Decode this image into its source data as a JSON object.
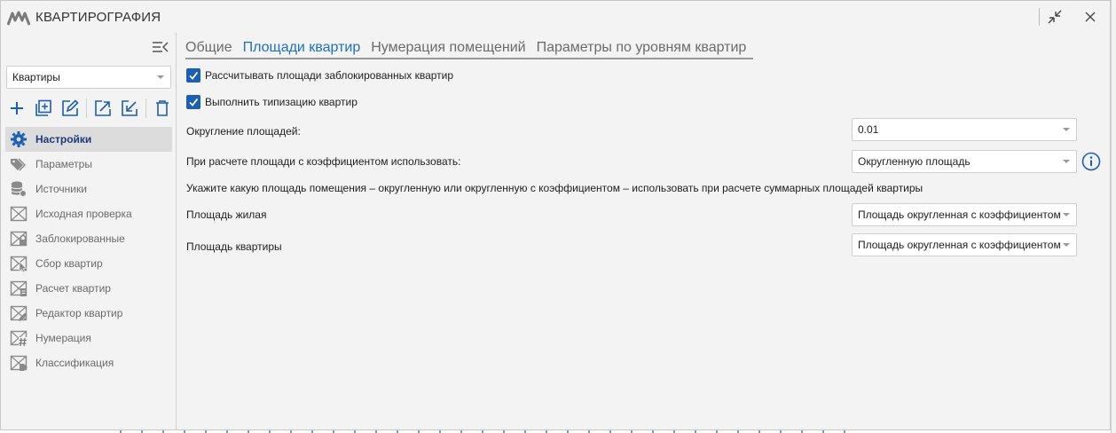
{
  "window": {
    "title": "КВАРТИРОГРАФИЯ"
  },
  "sidebar": {
    "dropdown_value": "Квартиры",
    "nav": [
      {
        "label": "Настройки",
        "icon": "gear-icon",
        "active": true
      },
      {
        "label": "Параметры",
        "icon": "tags-icon"
      },
      {
        "label": "Источники",
        "icon": "database-icon"
      },
      {
        "label": "Исходная проверка",
        "icon": "envelope-icon"
      },
      {
        "label": "Заблокированные",
        "icon": "envelope-lock-icon"
      },
      {
        "label": "Сбор квартир",
        "icon": "envelope-cursor-icon"
      },
      {
        "label": "Расчет квартир",
        "icon": "envelope-calc-icon"
      },
      {
        "label": "Редактор квартир",
        "icon": "envelope-edit-icon"
      },
      {
        "label": "Нумерация",
        "icon": "envelope-hash-icon"
      },
      {
        "label": "Классификация",
        "icon": "envelope-tag-icon"
      }
    ]
  },
  "tabs": [
    {
      "label": "Общие",
      "active": false
    },
    {
      "label": "Площади квартир",
      "active": true
    },
    {
      "label": "Нумерация помещений",
      "active": false
    },
    {
      "label": "Параметры по уровням квартир",
      "active": false
    }
  ],
  "settings": {
    "calc_blocked_label": "Рассчитывать площади заблокированных квартир",
    "calc_blocked_checked": true,
    "typify_label": "Выполнить типизацию квартир",
    "typify_checked": true,
    "rounding_label": "Округление площадей:",
    "rounding_value": "0.01",
    "coef_label": "При расчете площади с коэффициентом использовать:",
    "coef_value": "Округленную площадь",
    "hint": "Укажите какую площадь помещения – округленную или округленную с коэффициентом – использовать при расчете суммарных площадей квартиры",
    "living_label": "Площадь жилая",
    "living_value": "Площадь округленная с коэффициентом",
    "apt_label": "Площадь квартиры",
    "apt_value": "Площадь округленная с коэффициентом"
  },
  "colors": {
    "accent": "#1c6fc2",
    "checkbox": "#1a5fb4",
    "nav_active_text": "#1e3a7a"
  }
}
